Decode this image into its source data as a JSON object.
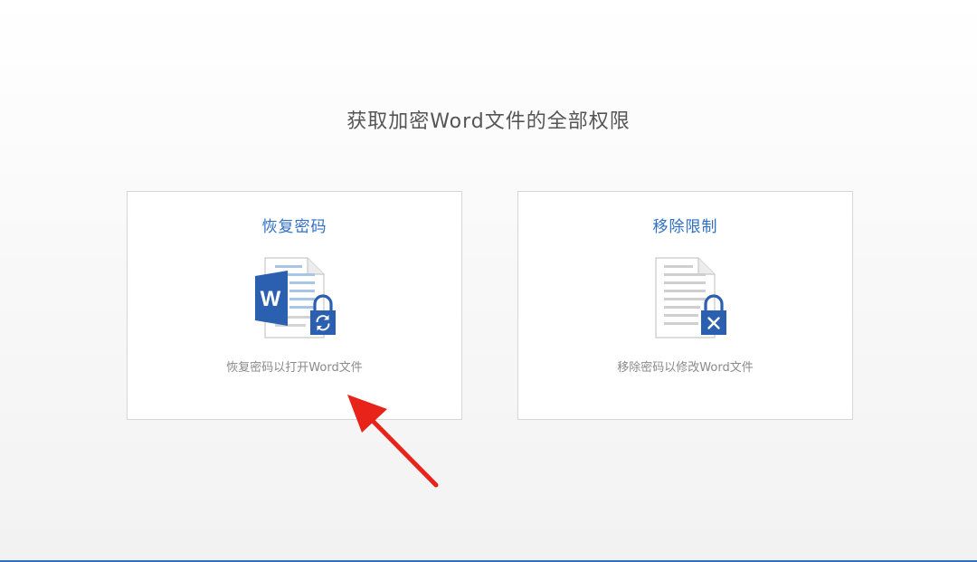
{
  "page": {
    "title": "获取加密Word文件的全部权限"
  },
  "cards": [
    {
      "title": "恢复密码",
      "description": "恢复密码以打开Word文件",
      "icon": "word-document-unlock-icon"
    },
    {
      "title": "移除限制",
      "description": "移除密码以修改Word文件",
      "icon": "document-lock-remove-icon"
    }
  ],
  "colors": {
    "accent": "#2f6fc4",
    "word_blue": "#2b5fb0",
    "arrow_red": "#e8231a",
    "card_border": "#d6d6d6",
    "bottom_bar": "#2b73c7"
  }
}
